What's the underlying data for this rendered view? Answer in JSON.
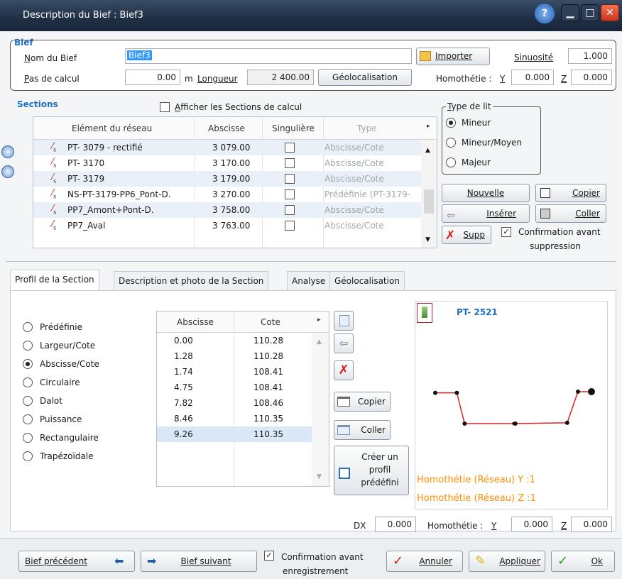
{
  "window": {
    "title": "Description du Bief : Bief3"
  },
  "bief": {
    "group_label": "Bief",
    "nom_label": "Nom du Bief",
    "nom_value": "Bief3",
    "pas_label": "Pas de calcul",
    "pas_value": "0.00",
    "pas_unit": "m",
    "longueur_label": "Longueur",
    "longueur_value": "2 400.00",
    "geoloc_button": "Géolocalisation",
    "importer_button": "Importer",
    "sinuosite_label": "Sinuosité",
    "sinuosite_value": "1.000",
    "homothetie_label": "Homothétie :",
    "y_label": "Y",
    "y_value": "0.000",
    "z_label": "Z",
    "z_value": "0.000"
  },
  "sections": {
    "label": "Sections",
    "afficher_label": "Afficher les Sections de calcul",
    "columns": [
      "Elément du réseau",
      "Abscisse",
      "Singulière",
      "Type"
    ],
    "rows": [
      {
        "name": "PT- 3079 - rectifié",
        "abscisse": "3 079.00",
        "type": "Abscisse/Cote"
      },
      {
        "name": "PT- 3170",
        "abscisse": "3 170.00",
        "type": "Abscisse/Cote"
      },
      {
        "name": "PT- 3179",
        "abscisse": "3 179.00",
        "type": "Abscisse/Cote"
      },
      {
        "name": "NS-PT-3179-PP6_Pont-D.",
        "abscisse": "3 270.00",
        "type": "Prédéfinie (PT-3179-"
      },
      {
        "name": "PP7_Amont+Pont-D.",
        "abscisse": "3 758.00",
        "type": "Abscisse/Cote"
      },
      {
        "name": "PP7_Aval",
        "abscisse": "3 763.00",
        "type": "Abscisse/Cote"
      }
    ]
  },
  "type_lit": {
    "label": "Type de lit",
    "options": [
      "Mineur",
      "Mineur/Moyen",
      "Majeur"
    ],
    "selected": "Mineur"
  },
  "section_buttons": {
    "nouvelle": "Nouvelle",
    "copier": "Copier",
    "inserer": "Insérer",
    "coller": "Coller",
    "supp": "Supp",
    "confirm_line1": "Confirmation avant",
    "confirm_line2": "suppression"
  },
  "tabs": [
    "Profil de la Section",
    "Description et photo de la Section",
    "Analyse",
    "Géolocalisation"
  ],
  "profile_types": {
    "options": [
      "Prédéfinie",
      "Largeur/Cote",
      "Abscisse/Cote",
      "Circulaire",
      "Dalot",
      "Puissance",
      "Rectangulaire",
      "Trapézoïdale"
    ],
    "selected": "Abscisse/Cote"
  },
  "profile_table": {
    "columns": [
      "Abscisse",
      "Cote"
    ],
    "rows": [
      [
        "0.00",
        "110.28"
      ],
      [
        "1.28",
        "110.28"
      ],
      [
        "1.74",
        "108.41"
      ],
      [
        "4.75",
        "108.41"
      ],
      [
        "7.82",
        "108.46"
      ],
      [
        "8.46",
        "110.35"
      ],
      [
        "9.26",
        "110.35"
      ]
    ]
  },
  "profile_buttons": {
    "copier": "Copier",
    "coller": "Coller",
    "creer_line1": "Créer un",
    "creer_line2": "profil",
    "creer_line3": "prédéfini"
  },
  "preview": {
    "section_name": "PT- 2521",
    "homothetie_y": "Homothétie (Réseau) Y :1",
    "homothetie_z": "Homothétie (Réseau) Z :1",
    "accent": "#ff8c00",
    "line_color": "#e02020"
  },
  "footer_fields": {
    "dx_label": "DX",
    "dx_value": "0.000",
    "homothetie_label": "Homothétie :",
    "y_label": "Y",
    "y_value": "0.000",
    "z_label": "Z",
    "z_value": "0.000"
  },
  "footer": {
    "prev": "Bief précédent",
    "next": "Bief suivant",
    "confirm_line1": "Confirmation avant",
    "confirm_line2": "enregistrement",
    "annuler": "Annuler",
    "appliquer": "Appliquer",
    "ok": "Ok"
  }
}
